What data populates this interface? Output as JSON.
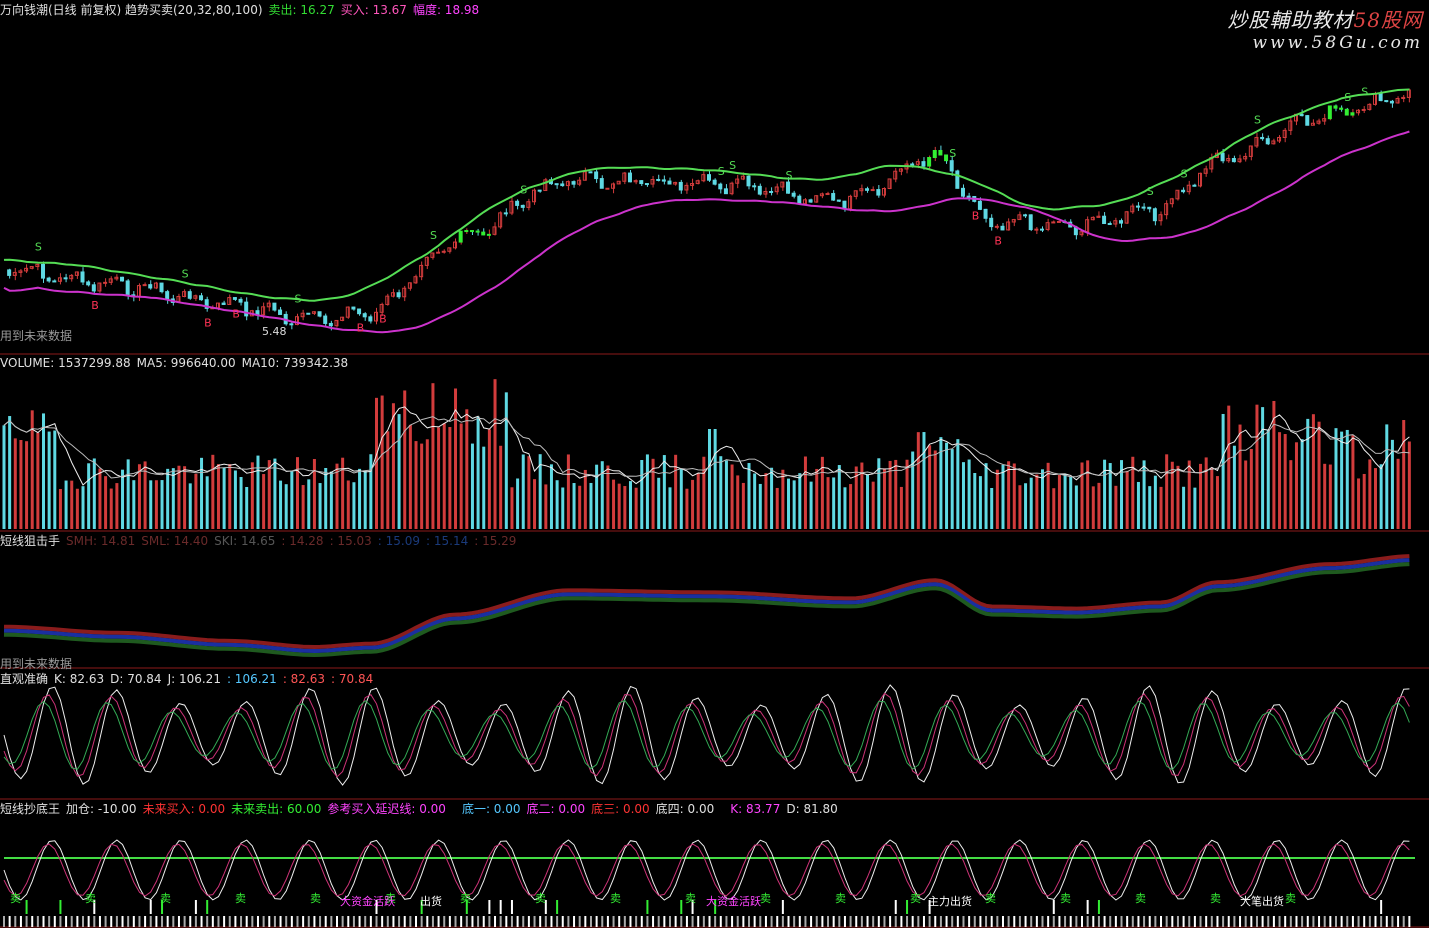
{
  "watermark": {
    "title": "炒股輔助教材",
    "brand": "58股网",
    "url": "www.58Gu.com"
  },
  "panel_main": {
    "title": "万向钱潮(日线 前复权) 趋势买卖(20,32,80,100)",
    "sell_label": "卖出: 16.27",
    "buy_label": "买入: 13.67",
    "amp_label": "幅度: 18.98",
    "low_marker": "5.48",
    "future_note": "用到未来数据",
    "colors": {
      "sell": "#33dd33",
      "buy": "#ff55bb",
      "amp": "#ff44ff"
    }
  },
  "panel_volume": {
    "title": "VOLUME: 1537299.88",
    "ma5": "MA5: 996640.00",
    "ma10": "MA10: 739342.38"
  },
  "panel_short": {
    "title": "短线狙击手",
    "values": [
      "SMH: 14.81",
      "SML: 14.40",
      "SKI: 14.65",
      ": 14.28",
      ": 15.03",
      ": 15.09",
      ": 15.14",
      ": 15.29"
    ],
    "future_note": "用到未来数据"
  },
  "panel_kdj": {
    "title": "直观准确",
    "k": "K: 82.63",
    "d": "D: 70.84",
    "j": "J: 106.21",
    "v1": ": 106.21",
    "v2": ": 82.63",
    "v3": ": 70.84"
  },
  "panel_bottom": {
    "title": "短线抄底王",
    "add": "加仓: -10.00",
    "future_buy": "未来买入: 0.00",
    "future_sell": "未来卖出: 60.00",
    "ref_buy": "参考买入延迟线: 0.00",
    "bottom1": "底一: 0.00",
    "bottom2": "底二: 0.00",
    "bottom3": "底三: 0.00",
    "bottom4": "底四: 0.00",
    "k": "K: 83.77",
    "d": "D: 81.80",
    "annotations": [
      "卖",
      "卖",
      "卖",
      "卖",
      "卖",
      "卖",
      "卖",
      "卖",
      "卖",
      "卖",
      "卖",
      "卖",
      "卖",
      "卖",
      "卖",
      "卖",
      "卖",
      "卖"
    ],
    "labels": [
      "大资金活跃",
      "出货",
      "大资金活跃",
      "主力出货",
      "大笔出货"
    ]
  },
  "colors": {
    "up": "#d23c3c",
    "down": "#5fd9e3",
    "green_line": "#55dd55",
    "magenta_line": "#cc33cc",
    "divider": "#8b1a1a"
  }
}
